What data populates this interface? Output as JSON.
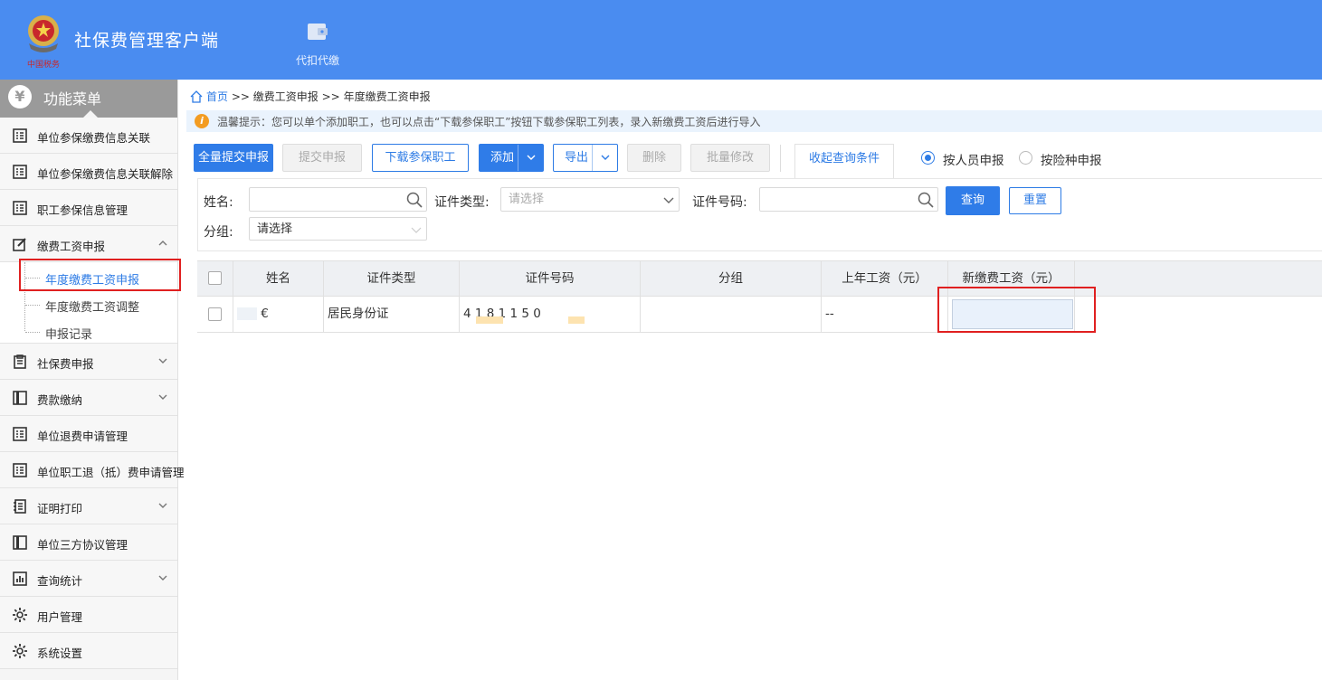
{
  "app": {
    "title": "社保费管理客户端",
    "logo_text": "中国税务"
  },
  "topnav": [
    {
      "label": "代扣代缴",
      "icon": "wallet-icon"
    }
  ],
  "sidebar": {
    "title": "功能菜单",
    "header_icon": "yen-icon",
    "items": [
      {
        "label": "单位参保缴费信息关联",
        "icon": "list-icon",
        "expandable": false
      },
      {
        "label": "单位参保缴费信息关联解除",
        "icon": "list-icon",
        "expandable": false
      },
      {
        "label": "职工参保信息管理",
        "icon": "list-icon",
        "expandable": false
      },
      {
        "label": "缴费工资申报",
        "icon": "edit-icon",
        "expandable": true,
        "expanded": true,
        "children": [
          {
            "label": "年度缴费工资申报",
            "active": true
          },
          {
            "label": "年度缴费工资调整",
            "active": false
          },
          {
            "label": "申报记录",
            "active": false
          }
        ]
      },
      {
        "label": "社保费申报",
        "icon": "clipboard-icon",
        "expandable": true
      },
      {
        "label": "费款缴纳",
        "icon": "book-icon",
        "expandable": true
      },
      {
        "label": "单位退费申请管理",
        "icon": "list-icon",
        "expandable": false
      },
      {
        "label": "单位职工退（抵）费申请管理",
        "icon": "list-icon",
        "expandable": false
      },
      {
        "label": "证明打印",
        "icon": "document-icon",
        "expandable": true
      },
      {
        "label": "单位三方协议管理",
        "icon": "book-icon",
        "expandable": false
      },
      {
        "label": "查询统计",
        "icon": "chart-icon",
        "expandable": true
      },
      {
        "label": "用户管理",
        "icon": "gear-icon",
        "expandable": false
      },
      {
        "label": "系统设置",
        "icon": "gear-icon",
        "expandable": false
      }
    ]
  },
  "breadcrumb": {
    "home": "首页",
    "sep": ">>",
    "level1": "缴费工资申报",
    "level2": "年度缴费工资申报"
  },
  "tip": {
    "text": "温馨提示：您可以单个添加职工，也可以点击“下载参保职工”按钮下载参保职工列表，录入新缴费工资后进行导入"
  },
  "toolbar": {
    "submit_all": "全量提交申报",
    "submit": "提交申报",
    "download": "下载参保职工",
    "add": "添加",
    "export": "导出",
    "delete": "删除",
    "batch_edit": "批量修改",
    "collapse_filter": "收起查询条件",
    "radio_by_person": "按人员申报",
    "radio_by_type": "按险种申报",
    "selected_mode": "按人员申报"
  },
  "filter": {
    "name_label": "姓名:",
    "name_value": "",
    "idtype_label": "证件类型:",
    "idtype_placeholder": "请选择",
    "idnum_label": "证件号码:",
    "idnum_value": "",
    "group_label": "分组:",
    "group_value": "请选择",
    "query_button": "查询",
    "reset_button": "重置"
  },
  "table": {
    "columns": [
      "姓名",
      "证件类型",
      "证件号码",
      "分组",
      "上年工资（元）",
      "新缴费工资（元）"
    ],
    "rows": [
      {
        "name": "€",
        "id_type": "居民身份证",
        "id_number": "4  1   8 1 1 5 0",
        "group": "",
        "last_year_salary": "--",
        "new_salary": ""
      }
    ]
  },
  "colors": {
    "header_bg": "#4a8cf0",
    "primary": "#2f7ce8",
    "highlight": "#e02020",
    "tip_icon": "#f39c22"
  }
}
